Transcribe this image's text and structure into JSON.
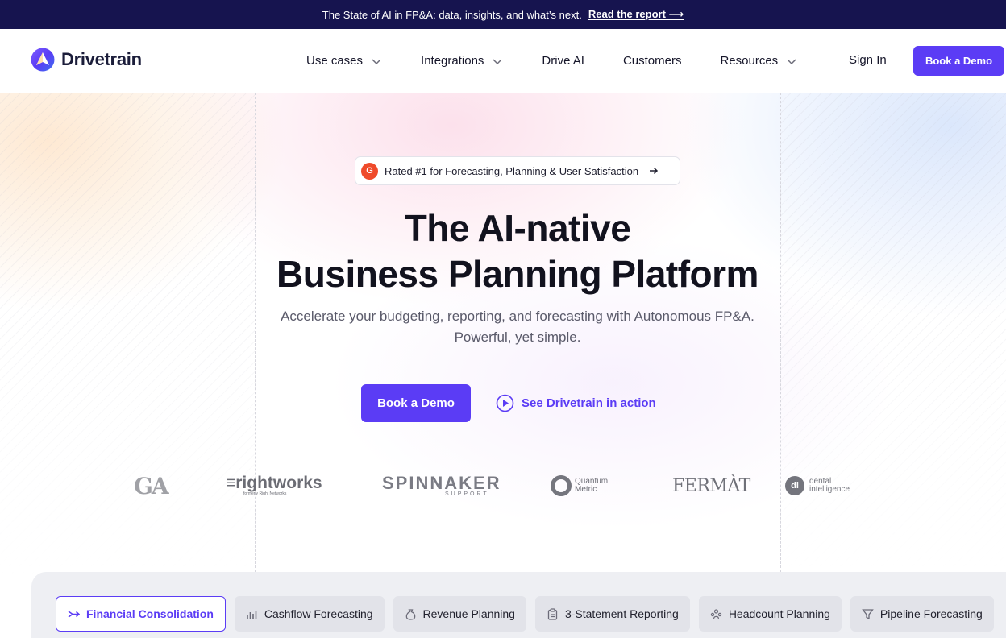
{
  "announcement": {
    "text": "The State of AI in FP&A: data, insights, and what’s next.",
    "link": "Read the report ⟶"
  },
  "nav": {
    "brand": "Drivetrain",
    "items": [
      {
        "label": "Use cases",
        "has_dropdown": true
      },
      {
        "label": "Integrations",
        "has_dropdown": true
      },
      {
        "label": "Drive AI",
        "has_dropdown": false
      },
      {
        "label": "Customers",
        "has_dropdown": false
      },
      {
        "label": "Resources",
        "has_dropdown": true
      }
    ],
    "sign_in": "Sign In",
    "cta": "Book a Demo"
  },
  "hero": {
    "badge": "Rated #1 for Forecasting, Planning & User Satisfaction",
    "badge_icon": "G",
    "headline_line1": "The AI-native",
    "headline_line2": "Business Planning Platform",
    "subtitle_line1": "Accelerate your budgeting, reporting, and forecasting with Autonomous FP&A.",
    "subtitle_line2": "Powerful, yet simple.",
    "primary_cta": "Book a Demo",
    "secondary_cta": "See Drivetrain in action"
  },
  "customer_logos": {
    "ga": "GA",
    "rightworks": "≡rightworks",
    "rightworks_sub": "formerly Right Networks",
    "spinnaker": "SPINNAKER",
    "spinnaker_sub": "SUPPORT",
    "quantum_1": "Quantum",
    "quantum_2": "Metric",
    "fermat": "FERMÀT",
    "di": "di",
    "dental_1": "dental",
    "dental_2": "intelligence"
  },
  "tabs": [
    {
      "label": "Financial Consolidation",
      "icon": "merge-arrows-icon",
      "active": true
    },
    {
      "label": "Cashflow Forecasting",
      "icon": "bar-chart-icon",
      "active": false
    },
    {
      "label": "Revenue Planning",
      "icon": "money-bag-icon",
      "active": false
    },
    {
      "label": "3-Statement Reporting",
      "icon": "clipboard-icon",
      "active": false
    },
    {
      "label": "Headcount Planning",
      "icon": "people-icon",
      "active": false
    },
    {
      "label": "Pipeline Forecasting",
      "icon": "funnel-icon",
      "active": false
    }
  ],
  "colors": {
    "accent": "#5b3cf5",
    "announcement_bg": "#16144f",
    "g2_red": "#ef4a2a"
  }
}
